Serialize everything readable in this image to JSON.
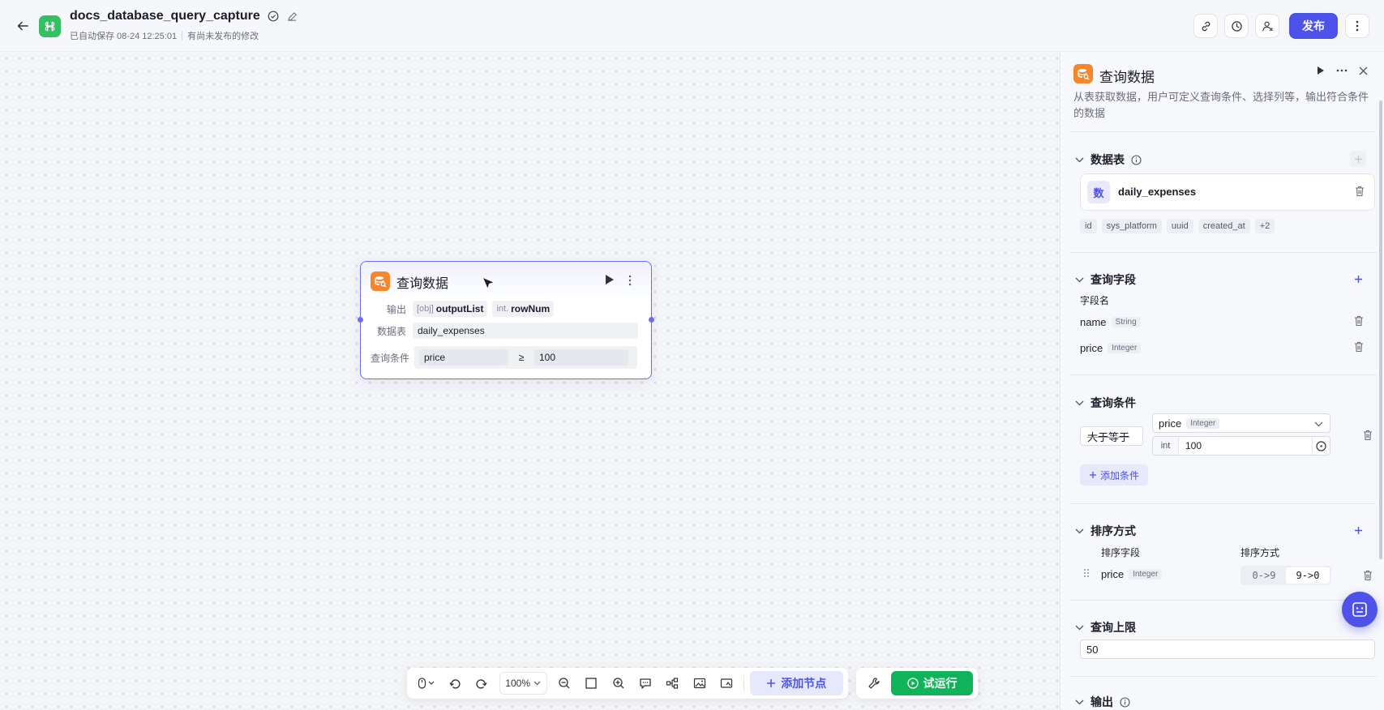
{
  "header": {
    "title": "docs_database_query_capture",
    "save_status": "已自动保存 08-24 12:25:01",
    "unpublished": "有尚未发布的修改",
    "publish_label": "发布"
  },
  "node": {
    "title": "查询数据",
    "output_label": "输出",
    "outputs": [
      {
        "prefix": "[obj]",
        "name": "outputList"
      },
      {
        "prefix": "int.",
        "name": "rowNum"
      }
    ],
    "table_label": "数据表",
    "table_value": "daily_expenses",
    "condition_label": "查询条件",
    "condition_field": "price",
    "condition_op": "≥",
    "condition_value": "100"
  },
  "toolbar": {
    "zoom": "100%",
    "add_node_label": "添加节点",
    "trial_run_label": "试运行"
  },
  "panel": {
    "title": "查询数据",
    "description": "从表获取数据，用户可定义查询条件、选择列等，输出符合条件的数据",
    "sections": {
      "table": "数据表",
      "fields": "查询字段",
      "conditions": "查询条件",
      "sort": "排序方式",
      "limit": "查询上限",
      "output": "输出"
    },
    "table": {
      "badge": "数",
      "name": "daily_expenses",
      "chips": [
        "id",
        "sys_platform",
        "uuid",
        "created_at",
        "+2"
      ]
    },
    "field_name_label": "字段名",
    "fields": [
      {
        "name": "name",
        "type": "String"
      },
      {
        "name": "price",
        "type": "Integer"
      }
    ],
    "condition": {
      "operator": "大于等于",
      "field": "price",
      "field_type": "Integer",
      "value_type": "int",
      "value": "100",
      "add_label": "添加条件"
    },
    "sort": {
      "field_header": "排序字段",
      "order_header": "排序方式",
      "field": "price",
      "field_type": "Integer",
      "asc": "0->9",
      "desc": "9->0",
      "selected": "desc"
    },
    "limit_value": "50"
  }
}
